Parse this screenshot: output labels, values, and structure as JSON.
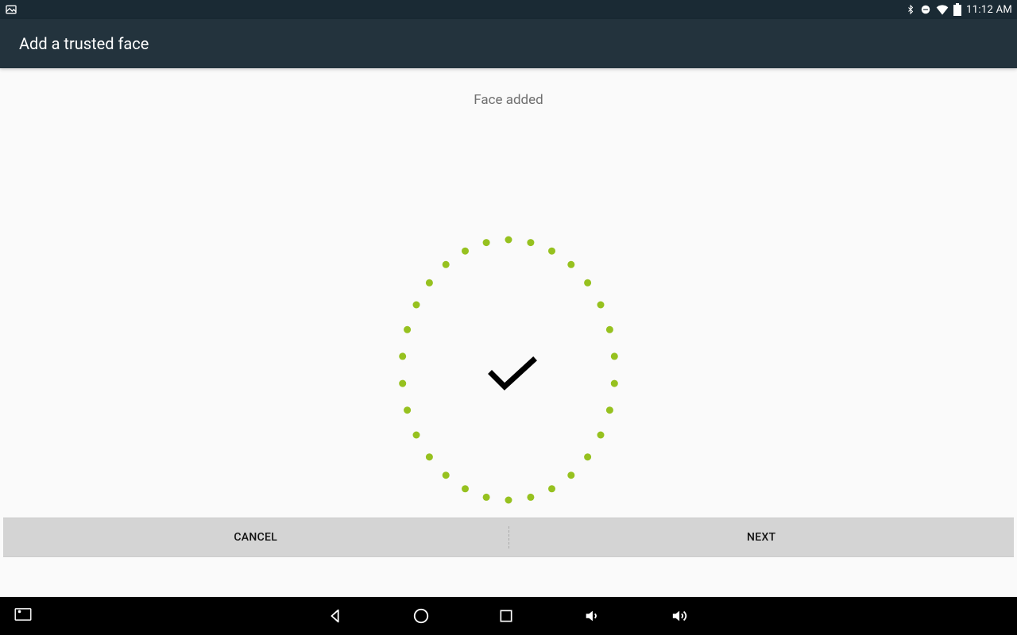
{
  "status_bar": {
    "time": "11:12 AM"
  },
  "app_bar": {
    "title": "Add a trusted face"
  },
  "content": {
    "status_text": "Face added"
  },
  "buttons": {
    "cancel": "CANCEL",
    "next": "NEXT"
  },
  "colors": {
    "dot": "#96c11f"
  }
}
